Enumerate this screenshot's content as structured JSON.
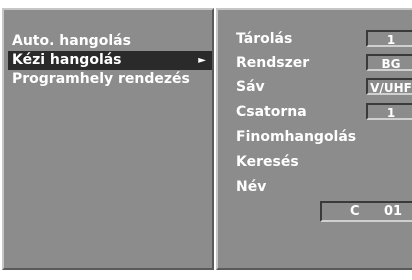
{
  "left_menu": {
    "items": [
      {
        "label": "Auto. hangolás"
      },
      {
        "label": "Kézi hangolás",
        "arrow": "►",
        "selected": true
      },
      {
        "label": "Programhely rendezés"
      }
    ]
  },
  "settings": {
    "storage": {
      "label": "Tárolás",
      "value": "1"
    },
    "system": {
      "label": "Rendszer",
      "value": "BG"
    },
    "band": {
      "label": "Sáv",
      "value": "V/UHF"
    },
    "channel": {
      "label": "Csatorna",
      "value": "1"
    },
    "fine_tuning": {
      "label": "Finomhangolás"
    },
    "search": {
      "label": "Keresés"
    },
    "name": {
      "label": "Név",
      "letter": "C",
      "number": "01"
    }
  },
  "colors": {
    "panel": "#8c8c8c",
    "selected_row": "#2a2a2a",
    "text": "#ffffff"
  }
}
